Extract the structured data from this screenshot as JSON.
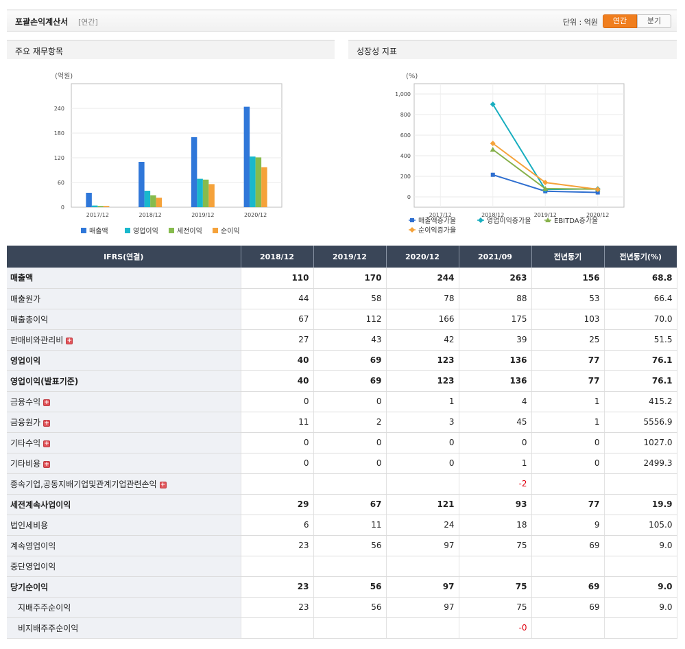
{
  "header": {
    "title": "포괄손익계산서",
    "subtitle": "[연간]",
    "unit": "단위 : 억원",
    "toggle_annual": "연간",
    "toggle_quarter": "분기"
  },
  "panels": {
    "left_title": "주요 재무항목",
    "right_title": "성장성 지표"
  },
  "chart_data": [
    {
      "type": "bar",
      "title": "",
      "ylabel": "(억원)",
      "xlabel": "",
      "categories": [
        "2017/12",
        "2018/12",
        "2019/12",
        "2020/12"
      ],
      "ylim": [
        0,
        300
      ],
      "yticks": [
        0,
        60,
        120,
        180,
        240
      ],
      "grid": true,
      "legend": "bottom",
      "series": [
        {
          "name": "매출액",
          "color": "#2f77d9",
          "values": [
            35,
            110,
            170,
            244
          ]
        },
        {
          "name": "영업이익",
          "color": "#19b8cc",
          "values": [
            4,
            40,
            69,
            123
          ]
        },
        {
          "name": "세전이익",
          "color": "#86bb4d",
          "values": [
            3,
            29,
            67,
            121
          ]
        },
        {
          "name": "순이익",
          "color": "#f5a23a",
          "values": [
            3,
            23,
            56,
            97
          ]
        }
      ]
    },
    {
      "type": "line",
      "title": "",
      "ylabel": "(%)",
      "xlabel": "",
      "categories": [
        "2017/12",
        "2018/12",
        "2019/12",
        "2020/12"
      ],
      "ylim": [
        -100,
        1100
      ],
      "yticks": [
        0,
        200,
        400,
        600,
        800,
        1000
      ],
      "ytick_labels": [
        "0",
        "200",
        "400",
        "600",
        "800",
        "1,000"
      ],
      "grid": true,
      "legend": "bottom",
      "series": [
        {
          "name": "매출액증가율",
          "color": "#2f6fd0",
          "marker": "square",
          "values": [
            null,
            215,
            55,
            43
          ]
        },
        {
          "name": "영업이익증가율",
          "color": "#19aebf",
          "marker": "diamond",
          "values": [
            null,
            900,
            72,
            78
          ]
        },
        {
          "name": "EBITDA증가율",
          "color": "#86b04a",
          "marker": "triangle",
          "values": [
            null,
            460,
            80,
            75
          ]
        },
        {
          "name": "순이익증가율",
          "color": "#f5a23a",
          "marker": "diamond",
          "values": [
            null,
            520,
            140,
            73
          ]
        }
      ]
    }
  ],
  "table": {
    "headers": [
      "IFRS(연결)",
      "2018/12",
      "2019/12",
      "2020/12",
      "2021/09",
      "전년동기",
      "전년동기(%)"
    ],
    "rows": [
      {
        "label": "매출액",
        "bold": true,
        "expand": false,
        "indent": false,
        "cells": [
          "110",
          "170",
          "244",
          "263",
          "156",
          "68.8"
        ]
      },
      {
        "label": "매출원가",
        "bold": false,
        "expand": false,
        "indent": false,
        "cells": [
          "44",
          "58",
          "78",
          "88",
          "53",
          "66.4"
        ]
      },
      {
        "label": "매출총이익",
        "bold": false,
        "expand": false,
        "indent": false,
        "cells": [
          "67",
          "112",
          "166",
          "175",
          "103",
          "70.0"
        ]
      },
      {
        "label": "판매비와관리비",
        "bold": false,
        "expand": true,
        "indent": false,
        "cells": [
          "27",
          "43",
          "42",
          "39",
          "25",
          "51.5"
        ]
      },
      {
        "label": "영업이익",
        "bold": true,
        "expand": false,
        "indent": false,
        "cells": [
          "40",
          "69",
          "123",
          "136",
          "77",
          "76.1"
        ]
      },
      {
        "label": "영업이익(발표기준)",
        "bold": true,
        "expand": false,
        "indent": false,
        "cells": [
          "40",
          "69",
          "123",
          "136",
          "77",
          "76.1"
        ]
      },
      {
        "label": "금융수익",
        "bold": false,
        "expand": true,
        "indent": false,
        "cells": [
          "0",
          "0",
          "1",
          "4",
          "1",
          "415.2"
        ]
      },
      {
        "label": "금융원가",
        "bold": false,
        "expand": true,
        "indent": false,
        "cells": [
          "11",
          "2",
          "3",
          "45",
          "1",
          "5556.9"
        ]
      },
      {
        "label": "기타수익",
        "bold": false,
        "expand": true,
        "indent": false,
        "cells": [
          "0",
          "0",
          "0",
          "0",
          "0",
          "1027.0"
        ]
      },
      {
        "label": "기타비용",
        "bold": false,
        "expand": true,
        "indent": false,
        "cells": [
          "0",
          "0",
          "0",
          "1",
          "0",
          "2499.3"
        ]
      },
      {
        "label": "종속기업,공동지배기업및관계기업관련손익",
        "bold": false,
        "expand": true,
        "indent": false,
        "cells": [
          "",
          "",
          "",
          "-2",
          "",
          ""
        ]
      },
      {
        "label": "세전계속사업이익",
        "bold": true,
        "expand": false,
        "indent": false,
        "cells": [
          "29",
          "67",
          "121",
          "93",
          "77",
          "19.9"
        ]
      },
      {
        "label": "법인세비용",
        "bold": false,
        "expand": false,
        "indent": false,
        "cells": [
          "6",
          "11",
          "24",
          "18",
          "9",
          "105.0"
        ]
      },
      {
        "label": "계속영업이익",
        "bold": false,
        "expand": false,
        "indent": false,
        "cells": [
          "23",
          "56",
          "97",
          "75",
          "69",
          "9.0"
        ]
      },
      {
        "label": "중단영업이익",
        "bold": false,
        "expand": false,
        "indent": false,
        "cells": [
          "",
          "",
          "",
          "",
          "",
          ""
        ]
      },
      {
        "label": "당기순이익",
        "bold": true,
        "expand": false,
        "indent": false,
        "cells": [
          "23",
          "56",
          "97",
          "75",
          "69",
          "9.0"
        ]
      },
      {
        "label": "지배주주순이익",
        "bold": false,
        "expand": false,
        "indent": true,
        "cells": [
          "23",
          "56",
          "97",
          "75",
          "69",
          "9.0"
        ]
      },
      {
        "label": "비지배주주순이익",
        "bold": false,
        "expand": false,
        "indent": true,
        "cells": [
          "",
          "",
          "",
          "-0",
          "",
          ""
        ]
      }
    ]
  }
}
